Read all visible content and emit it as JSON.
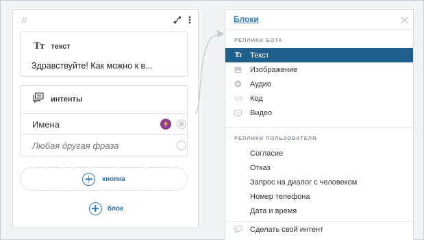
{
  "block": {
    "hash": "#",
    "text_card": {
      "icon": "Тт",
      "title": "текст",
      "body": "Здравствуйте! Как можно к в..."
    },
    "intents_card": {
      "title": "интенты",
      "rows": [
        {
          "label": "Имена"
        },
        {
          "label": "Любая другая фраза"
        }
      ]
    },
    "add_button_label": "кнопка",
    "add_block_label": "блок"
  },
  "panel": {
    "title": "Блоки",
    "bot_section_label": "Реплики бота",
    "bot_items": [
      {
        "icon": "Тт",
        "label": "Текст"
      },
      {
        "icon": "image-icon",
        "label": "Изображение"
      },
      {
        "icon": "audio-icon",
        "label": "Аудио"
      },
      {
        "icon": "code-icon",
        "label": "Код"
      },
      {
        "icon": "video-icon",
        "label": "Видео"
      }
    ],
    "user_section_label": "Реплики пользователя",
    "user_items": [
      {
        "label": "Согласие"
      },
      {
        "label": "Отказ"
      },
      {
        "label": "Запрос на диалог с человеком"
      },
      {
        "label": "Номер телефона"
      },
      {
        "label": "Дата и время"
      }
    ],
    "custom_intent_label": "Сделать свой интент"
  },
  "colors": {
    "accent": "#2b7ab5",
    "selected_bg": "#1f5f8b",
    "bolt": "#8d3f8f"
  }
}
